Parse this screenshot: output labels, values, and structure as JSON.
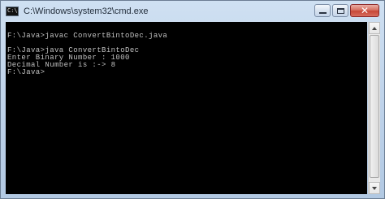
{
  "window": {
    "title": "C:\\Windows\\system32\\cmd.exe",
    "icon_name": "cmd-app-icon",
    "icon_glyph": "C:\\"
  },
  "controls": {
    "minimize_icon": "minimize-icon",
    "maximize_icon": "maximize-icon",
    "close_icon": "close-icon",
    "close_glyph": "✕"
  },
  "console": {
    "lines": [
      "",
      "F:\\Java>javac ConvertBintoDec.java",
      "",
      "F:\\Java>java ConvertBintoDec",
      "Enter Binary Number : 1000",
      "Decimal Number is :-> 8",
      "F:\\Java>"
    ]
  },
  "colors": {
    "console_background": "#000000",
    "console_text": "#c0c0c0",
    "close_button": "#c74737",
    "frame": "#bfd3ea"
  }
}
